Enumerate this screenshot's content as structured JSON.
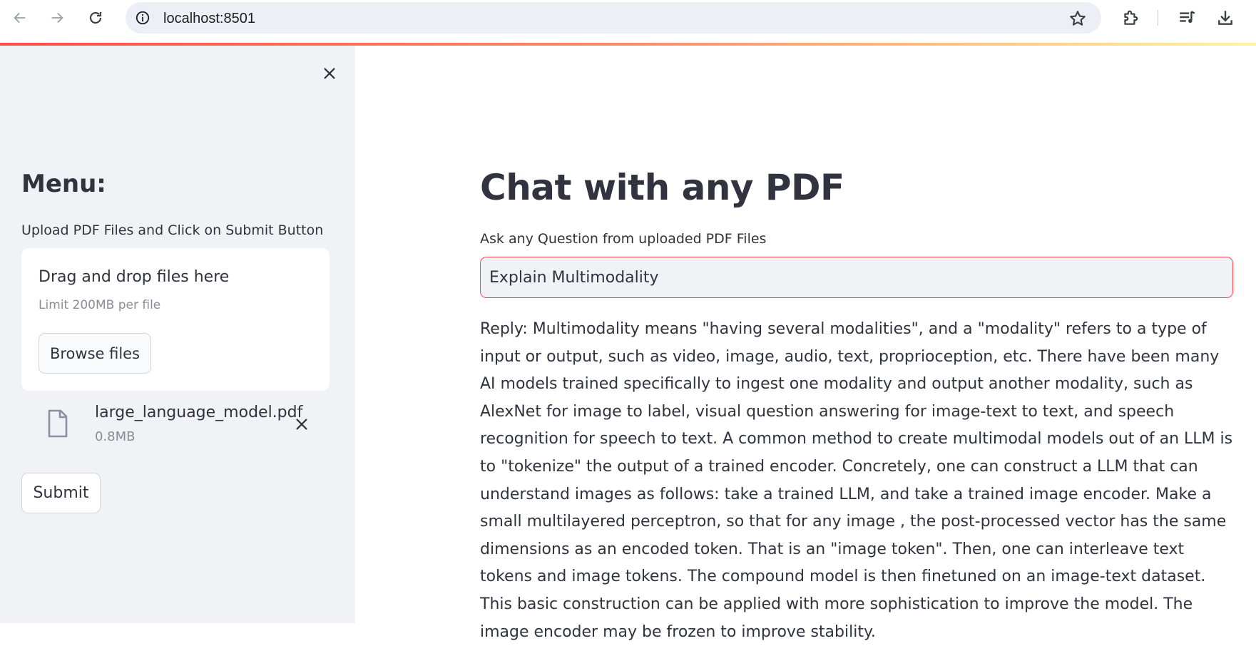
{
  "browser": {
    "url": "localhost:8501",
    "icons": {
      "back": "back-arrow-icon",
      "forward": "forward-arrow-icon",
      "reload": "reload-icon",
      "site_info": "site-info-icon",
      "bookmark": "star-icon",
      "extensions": "puzzle-icon",
      "media": "media-control-icon",
      "downloads": "download-icon"
    }
  },
  "sidebar": {
    "heading": "Menu:",
    "upload_label": "Upload PDF Files and Click on Submit Button",
    "dropzone": {
      "title": "Drag and drop files here",
      "limit": "Limit 200MB per file",
      "browse_label": "Browse files"
    },
    "uploaded_file": {
      "name": "large_language_model.pdf",
      "size": "0.8MB"
    },
    "submit_label": "Submit"
  },
  "main": {
    "title": "Chat with any PDF",
    "question_label": "Ask any Question from uploaded PDF Files",
    "question_value": "Explain Multimodality",
    "reply": "Reply: Multimodality means \"having several modalities\", and a \"modality\" refers to a type of input or output, such as video, image, audio, text, proprioception, etc. There have been many AI models trained specifically to ingest one modality and output another modality, such as AlexNet for image to label, visual question answering for image-text to text, and speech recognition for speech to text. A common method to create multimodal models out of an LLM is to \"tokenize\" the output of a trained encoder. Concretely, one can construct a LLM that can understand images as follows: take a trained LLM, and take a trained image encoder. Make a small multilayered perceptron, so that for any image , the post-processed vector has the same dimensions as an encoded token. That is an \"image token\". Then, one can interleave text tokens and image tokens. The compound model is then finetuned on an image-text dataset. This basic construction can be applied with more sophistication to improve the model. The image encoder may be frozen to improve stability."
  },
  "colors": {
    "accent": "#ff4b4b",
    "sidebar_bg": "#f0f2f6",
    "text": "#31333f",
    "muted_text": "#8a8c96"
  }
}
